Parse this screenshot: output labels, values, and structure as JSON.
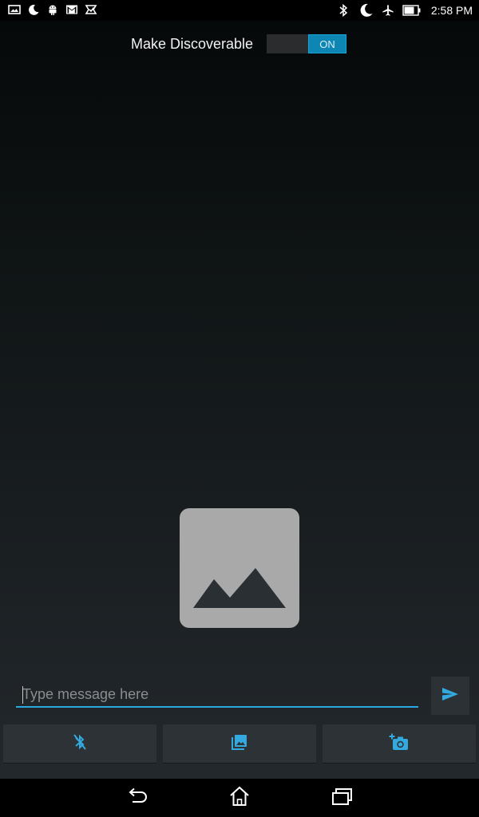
{
  "status_bar": {
    "left_icons": [
      "image-icon",
      "moon-icon",
      "android-icon",
      "gmail-icon",
      "store-icon"
    ],
    "right_icons": [
      "bluetooth-icon",
      "moon-icon",
      "airplane-icon",
      "battery-icon"
    ],
    "time": "2:58 PM"
  },
  "discoverable": {
    "label": "Make Discoverable",
    "toggle_state": "ON"
  },
  "message": {
    "placeholder": "Type message here",
    "value": ""
  },
  "actions": {
    "send_icon": "send-icon",
    "buttons": [
      "bluetooth-off-icon",
      "photo-library-icon",
      "add-camera-icon"
    ]
  },
  "colors": {
    "accent": "#2aa8e0",
    "toggle_on": "#0e86b3",
    "placeholder_image": "#a9a9a9",
    "button_bg": "#2c3236"
  },
  "nav_bar": {
    "buttons": [
      "back-icon",
      "home-icon",
      "recent-apps-icon"
    ]
  }
}
